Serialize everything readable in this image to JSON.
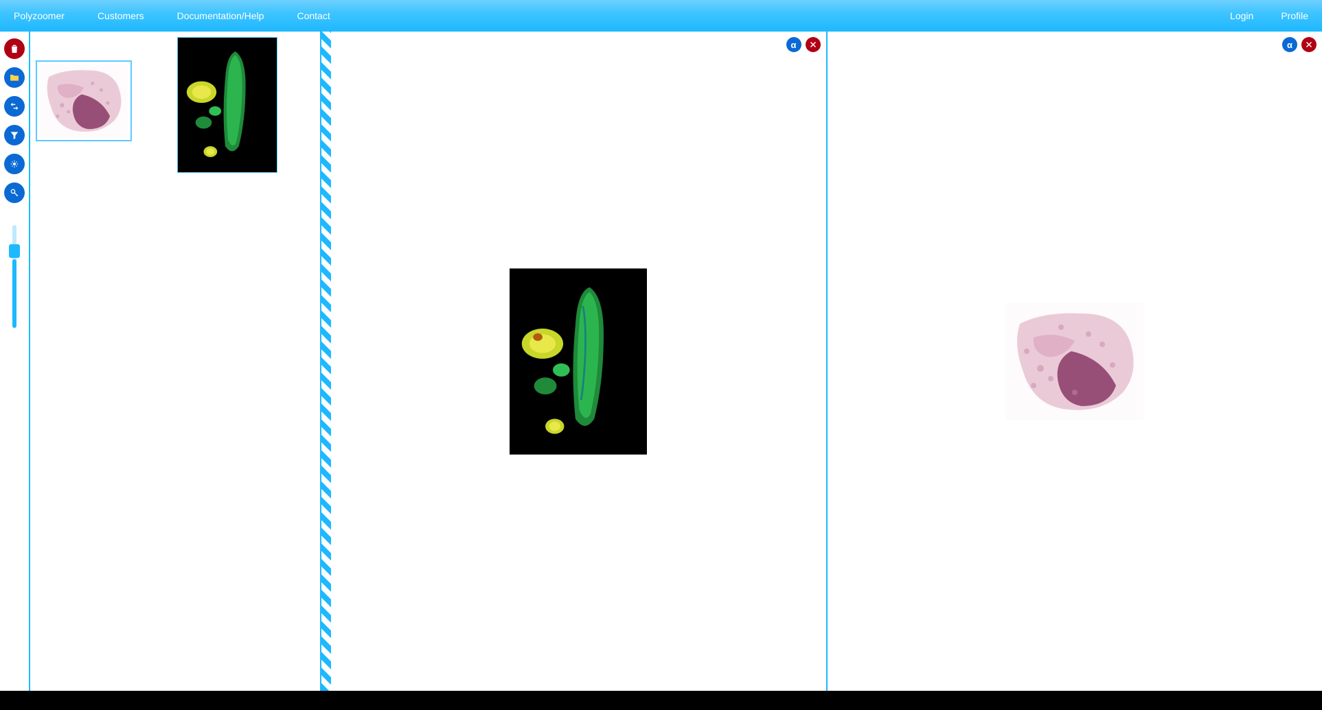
{
  "nav": {
    "left": [
      {
        "label": "Polyzoomer"
      },
      {
        "label": "Customers"
      },
      {
        "label": "Documentation/Help"
      },
      {
        "label": "Contact"
      }
    ],
    "right": [
      {
        "label": "Login"
      },
      {
        "label": "Profile"
      }
    ]
  },
  "toolbar": {
    "buttons": [
      {
        "name": "delete-button",
        "icon": "trash",
        "color": "red"
      },
      {
        "name": "open-button",
        "icon": "folder",
        "color": "blue"
      },
      {
        "name": "sync-button",
        "icon": "arrows",
        "color": "blue"
      },
      {
        "name": "filter-button",
        "icon": "funnel",
        "color": "blue"
      },
      {
        "name": "settings-button",
        "icon": "adjust",
        "color": "blue"
      },
      {
        "name": "key-button",
        "icon": "key",
        "color": "blue"
      }
    ],
    "alpha_label": "α"
  },
  "viewer_controls": {
    "alpha": "α",
    "close": "✕"
  }
}
